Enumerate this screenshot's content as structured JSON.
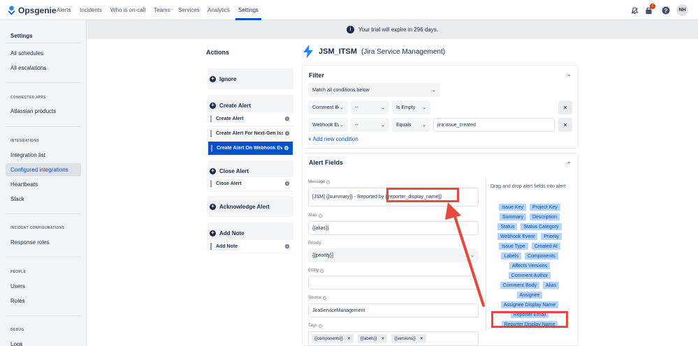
{
  "app": {
    "name": "Opsgenie"
  },
  "nav": {
    "items": [
      "Alerts",
      "Incidents",
      "Who is on-call",
      "Teams",
      "Services",
      "Analytics",
      "Settings"
    ],
    "active": "Settings",
    "notification_count": "2",
    "user_initials": "NH"
  },
  "sidebar": {
    "title": "Settings",
    "top_items": [
      "All schedules",
      "All escalations"
    ],
    "sections": [
      {
        "heading": "CONNECTED APPS",
        "items": [
          "Atlassian products"
        ]
      },
      {
        "heading": "INTEGRATIONS",
        "items": [
          "Integration list",
          "Configured integrations",
          "Heartbeats",
          "Slack"
        ]
      },
      {
        "heading": "INCIDENT CONFIGURATIONS",
        "items": [
          "Response roles"
        ]
      },
      {
        "heading": "PEOPLE",
        "items": [
          "Users",
          "Roles"
        ]
      },
      {
        "heading": "DEBUG",
        "items": [
          "Logs"
        ]
      }
    ],
    "active_item": "Configured integrations"
  },
  "banner": {
    "text": "Your trial will expire in 296 days."
  },
  "actions": {
    "title": "Actions",
    "groups": [
      {
        "label": "Ignore",
        "rows": []
      },
      {
        "label": "Create Alert",
        "rows": [
          "Create Alert",
          "Create Alert For Next-Gen Issues",
          "Create Alert On Webhook Events"
        ]
      },
      {
        "label": "Close Alert",
        "rows": [
          "Close Alert"
        ]
      },
      {
        "label": "Acknowledge Alert",
        "rows": []
      },
      {
        "label": "Add Note",
        "rows": [
          "Add Note"
        ]
      }
    ],
    "selected_row": "Create Alert On Webhook Events"
  },
  "integration": {
    "name": "JSM_ITSM",
    "subtitle": "(Jira Service Management)"
  },
  "filter": {
    "title": "Filter",
    "match": "Match all conditions below",
    "conditions": [
      {
        "field": "Comment Body",
        "not": "--",
        "operator": "Is Empty",
        "value": ""
      },
      {
        "field": "Webhook Event",
        "not": "--",
        "operator": "Equals",
        "value": "jira:issue_created"
      }
    ],
    "add_label": "+ Add new condition"
  },
  "alert_fields": {
    "title": "Alert Fields",
    "message_label": "Message",
    "message_value": "[JSM] {{summary}} - Reported by {{reporter_display_name}}",
    "alias_label": "Alias",
    "alias_value": "{{alias}}",
    "priority_label": "Priority",
    "priority_value": "{{priority}}",
    "entity_label": "Entity",
    "entity_value": "",
    "source_label": "Source",
    "source_value": "JiraServiceManagement",
    "tags_label": "Tags",
    "tags": [
      "{{components}}",
      "{{labels}}",
      "{{versions}}"
    ]
  },
  "drag_panel": {
    "help": "Drag and drop alert fields into alert",
    "fields": [
      "Issue Key",
      "Project Key",
      "Summary",
      "Description",
      "Status",
      "Status Category",
      "Webhook Event",
      "Priority",
      "Issue Type",
      "Created At",
      "Labels",
      "Components",
      "Affects Versions",
      "Comment Author",
      "Comment Body",
      "Alias",
      "Assignee",
      "Assignee Display Name",
      "Reporter Email",
      "Reporter Display Name"
    ]
  },
  "colors": {
    "brand": "#0052cc",
    "highlight": "#e8483e",
    "chip_bg": "#b3d4ff"
  }
}
